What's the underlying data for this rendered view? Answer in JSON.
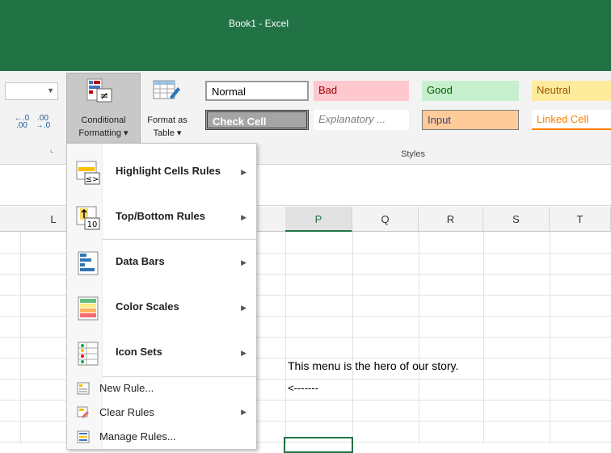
{
  "window": {
    "title": "Book1 - Excel"
  },
  "ribbon": {
    "conditional_formatting": {
      "line1": "Conditional",
      "line2": "Formatting ▾"
    },
    "format_as_table": {
      "line1": "Format as",
      "line2": "Table ▾"
    },
    "increase_decimal": "←.0\n.00",
    "decrease_decimal": ".00\n→.0",
    "styles_group_label": "Styles",
    "cell_styles": [
      {
        "label": "Normal",
        "bg": "#ffffff",
        "color": "#000000"
      },
      {
        "label": "Bad",
        "bg": "#ffc7ce",
        "color": "#9c0006"
      },
      {
        "label": "Good",
        "bg": "#c6efce",
        "color": "#006100"
      },
      {
        "label": "Neutral",
        "bg": "#ffeb9c",
        "color": "#9c5700"
      },
      {
        "label": "Check Cell",
        "bg": "#a5a5a5",
        "color": "#ffffff"
      },
      {
        "label": "Explanatory ...",
        "bg": "#ffffff",
        "color": "#7f7f7f"
      },
      {
        "label": "Input",
        "bg": "#ffcc99",
        "color": "#3f3f76"
      },
      {
        "label": "Linked Cell",
        "bg": "#ffffff",
        "color": "#fa7d00"
      }
    ]
  },
  "columns": [
    "L",
    "P",
    "Q",
    "R",
    "S",
    "T"
  ],
  "selected_column": "P",
  "cells": {
    "hero_text": "This menu is the hero of our story.",
    "arrow_text": "<-------"
  },
  "menu": {
    "items": [
      {
        "label": "Highlight Cells Rules",
        "icon": "highlight-cells-icon",
        "submenu": true
      },
      {
        "label": "Top/Bottom Rules",
        "icon": "top-bottom-icon",
        "submenu": true
      },
      {
        "label": "Data Bars",
        "icon": "data-bars-icon",
        "submenu": true
      },
      {
        "label": "Color Scales",
        "icon": "color-scales-icon",
        "submenu": true
      },
      {
        "label": "Icon Sets",
        "icon": "icon-sets-icon",
        "submenu": true
      }
    ],
    "actions": [
      {
        "label": "New Rule...",
        "icon": "new-rule-icon",
        "submenu": false
      },
      {
        "label": "Clear Rules",
        "icon": "clear-rules-icon",
        "submenu": true
      },
      {
        "label": "Manage Rules...",
        "icon": "manage-rules-icon",
        "submenu": false
      }
    ]
  },
  "colors": {
    "excel_green": "#217346"
  }
}
